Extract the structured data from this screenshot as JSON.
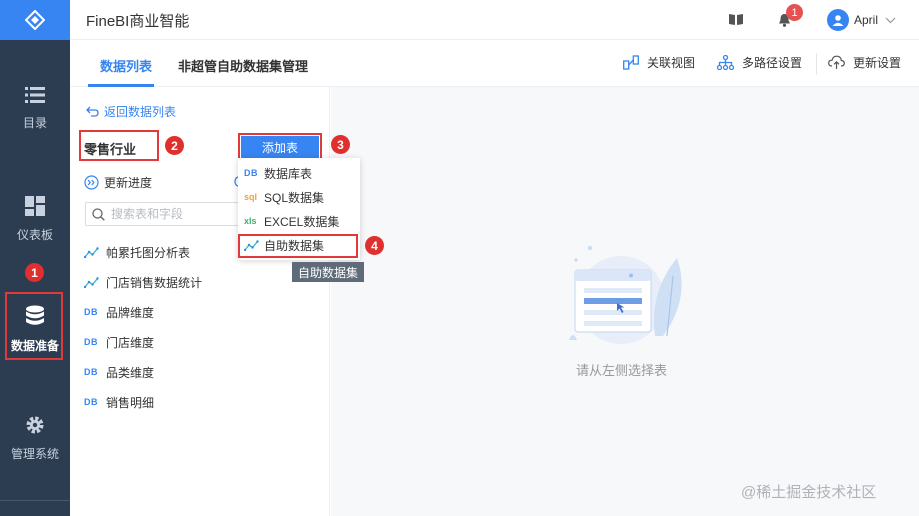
{
  "app": {
    "title": "FineBI商业智能"
  },
  "nav": {
    "items": [
      {
        "label": "目录"
      },
      {
        "label": "仪表板"
      },
      {
        "label": "数据准备"
      },
      {
        "label": "管理系统"
      }
    ],
    "marker": "1"
  },
  "header": {
    "notification_count": "1",
    "user_name": "April"
  },
  "tabs": [
    {
      "label": "数据列表"
    },
    {
      "label": "非超管自助数据集管理"
    }
  ],
  "toolbar": {
    "relation_view": "关联视图",
    "multipath": "多路径设置",
    "update_settings": "更新设置"
  },
  "panel": {
    "back_label": "返回数据列表",
    "package_name": "零售行业",
    "add_table_label": "添加表",
    "update_progress_label": "更新进度",
    "search_placeholder": "搜索表和字段",
    "items": [
      {
        "label": "帕累托图分析表",
        "icon": "self-service-icon"
      },
      {
        "label": "门店销售数据统计",
        "icon": "self-service-icon"
      },
      {
        "label": "品牌维度",
        "icon": "DB"
      },
      {
        "label": "门店维度",
        "icon": "DB"
      },
      {
        "label": "品类维度",
        "icon": "DB"
      },
      {
        "label": "销售明细",
        "icon": "DB"
      }
    ]
  },
  "dropdown": {
    "items": [
      {
        "tag": "DB",
        "label": "数据库表"
      },
      {
        "tag": "sql",
        "label": "SQL数据集"
      },
      {
        "tag": "xls",
        "label": "EXCEL数据集"
      },
      {
        "tag": "self-service-icon",
        "label": "自助数据集"
      }
    ],
    "tooltip": "自助数据集"
  },
  "markers": {
    "m2": "2",
    "m3": "3",
    "m4": "4"
  },
  "main": {
    "empty_text": "请从左侧选择表"
  },
  "watermark": "@稀土掘金技术社区",
  "colors": {
    "accent": "#3685f2",
    "rail": "#2c3d52",
    "marker_red": "#e0302e"
  }
}
